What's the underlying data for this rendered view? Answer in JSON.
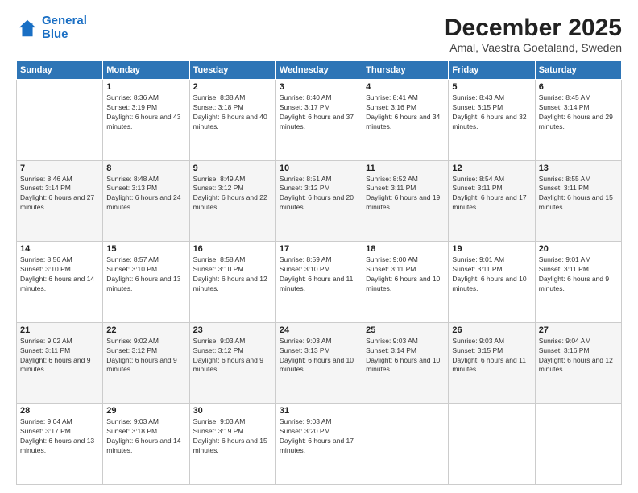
{
  "logo": {
    "line1": "General",
    "line2": "Blue"
  },
  "title": "December 2025",
  "subtitle": "Amal, Vaestra Goetaland, Sweden",
  "days_of_week": [
    "Sunday",
    "Monday",
    "Tuesday",
    "Wednesday",
    "Thursday",
    "Friday",
    "Saturday"
  ],
  "weeks": [
    [
      {
        "day": "",
        "sunrise": "",
        "sunset": "",
        "daylight": ""
      },
      {
        "day": "1",
        "sunrise": "Sunrise: 8:36 AM",
        "sunset": "Sunset: 3:19 PM",
        "daylight": "Daylight: 6 hours and 43 minutes."
      },
      {
        "day": "2",
        "sunrise": "Sunrise: 8:38 AM",
        "sunset": "Sunset: 3:18 PM",
        "daylight": "Daylight: 6 hours and 40 minutes."
      },
      {
        "day": "3",
        "sunrise": "Sunrise: 8:40 AM",
        "sunset": "Sunset: 3:17 PM",
        "daylight": "Daylight: 6 hours and 37 minutes."
      },
      {
        "day": "4",
        "sunrise": "Sunrise: 8:41 AM",
        "sunset": "Sunset: 3:16 PM",
        "daylight": "Daylight: 6 hours and 34 minutes."
      },
      {
        "day": "5",
        "sunrise": "Sunrise: 8:43 AM",
        "sunset": "Sunset: 3:15 PM",
        "daylight": "Daylight: 6 hours and 32 minutes."
      },
      {
        "day": "6",
        "sunrise": "Sunrise: 8:45 AM",
        "sunset": "Sunset: 3:14 PM",
        "daylight": "Daylight: 6 hours and 29 minutes."
      }
    ],
    [
      {
        "day": "7",
        "sunrise": "Sunrise: 8:46 AM",
        "sunset": "Sunset: 3:14 PM",
        "daylight": "Daylight: 6 hours and 27 minutes."
      },
      {
        "day": "8",
        "sunrise": "Sunrise: 8:48 AM",
        "sunset": "Sunset: 3:13 PM",
        "daylight": "Daylight: 6 hours and 24 minutes."
      },
      {
        "day": "9",
        "sunrise": "Sunrise: 8:49 AM",
        "sunset": "Sunset: 3:12 PM",
        "daylight": "Daylight: 6 hours and 22 minutes."
      },
      {
        "day": "10",
        "sunrise": "Sunrise: 8:51 AM",
        "sunset": "Sunset: 3:12 PM",
        "daylight": "Daylight: 6 hours and 20 minutes."
      },
      {
        "day": "11",
        "sunrise": "Sunrise: 8:52 AM",
        "sunset": "Sunset: 3:11 PM",
        "daylight": "Daylight: 6 hours and 19 minutes."
      },
      {
        "day": "12",
        "sunrise": "Sunrise: 8:54 AM",
        "sunset": "Sunset: 3:11 PM",
        "daylight": "Daylight: 6 hours and 17 minutes."
      },
      {
        "day": "13",
        "sunrise": "Sunrise: 8:55 AM",
        "sunset": "Sunset: 3:11 PM",
        "daylight": "Daylight: 6 hours and 15 minutes."
      }
    ],
    [
      {
        "day": "14",
        "sunrise": "Sunrise: 8:56 AM",
        "sunset": "Sunset: 3:10 PM",
        "daylight": "Daylight: 6 hours and 14 minutes."
      },
      {
        "day": "15",
        "sunrise": "Sunrise: 8:57 AM",
        "sunset": "Sunset: 3:10 PM",
        "daylight": "Daylight: 6 hours and 13 minutes."
      },
      {
        "day": "16",
        "sunrise": "Sunrise: 8:58 AM",
        "sunset": "Sunset: 3:10 PM",
        "daylight": "Daylight: 6 hours and 12 minutes."
      },
      {
        "day": "17",
        "sunrise": "Sunrise: 8:59 AM",
        "sunset": "Sunset: 3:10 PM",
        "daylight": "Daylight: 6 hours and 11 minutes."
      },
      {
        "day": "18",
        "sunrise": "Sunrise: 9:00 AM",
        "sunset": "Sunset: 3:11 PM",
        "daylight": "Daylight: 6 hours and 10 minutes."
      },
      {
        "day": "19",
        "sunrise": "Sunrise: 9:01 AM",
        "sunset": "Sunset: 3:11 PM",
        "daylight": "Daylight: 6 hours and 10 minutes."
      },
      {
        "day": "20",
        "sunrise": "Sunrise: 9:01 AM",
        "sunset": "Sunset: 3:11 PM",
        "daylight": "Daylight: 6 hours and 9 minutes."
      }
    ],
    [
      {
        "day": "21",
        "sunrise": "Sunrise: 9:02 AM",
        "sunset": "Sunset: 3:11 PM",
        "daylight": "Daylight: 6 hours and 9 minutes."
      },
      {
        "day": "22",
        "sunrise": "Sunrise: 9:02 AM",
        "sunset": "Sunset: 3:12 PM",
        "daylight": "Daylight: 6 hours and 9 minutes."
      },
      {
        "day": "23",
        "sunrise": "Sunrise: 9:03 AM",
        "sunset": "Sunset: 3:12 PM",
        "daylight": "Daylight: 6 hours and 9 minutes."
      },
      {
        "day": "24",
        "sunrise": "Sunrise: 9:03 AM",
        "sunset": "Sunset: 3:13 PM",
        "daylight": "Daylight: 6 hours and 10 minutes."
      },
      {
        "day": "25",
        "sunrise": "Sunrise: 9:03 AM",
        "sunset": "Sunset: 3:14 PM",
        "daylight": "Daylight: 6 hours and 10 minutes."
      },
      {
        "day": "26",
        "sunrise": "Sunrise: 9:03 AM",
        "sunset": "Sunset: 3:15 PM",
        "daylight": "Daylight: 6 hours and 11 minutes."
      },
      {
        "day": "27",
        "sunrise": "Sunrise: 9:04 AM",
        "sunset": "Sunset: 3:16 PM",
        "daylight": "Daylight: 6 hours and 12 minutes."
      }
    ],
    [
      {
        "day": "28",
        "sunrise": "Sunrise: 9:04 AM",
        "sunset": "Sunset: 3:17 PM",
        "daylight": "Daylight: 6 hours and 13 minutes."
      },
      {
        "day": "29",
        "sunrise": "Sunrise: 9:03 AM",
        "sunset": "Sunset: 3:18 PM",
        "daylight": "Daylight: 6 hours and 14 minutes."
      },
      {
        "day": "30",
        "sunrise": "Sunrise: 9:03 AM",
        "sunset": "Sunset: 3:19 PM",
        "daylight": "Daylight: 6 hours and 15 minutes."
      },
      {
        "day": "31",
        "sunrise": "Sunrise: 9:03 AM",
        "sunset": "Sunset: 3:20 PM",
        "daylight": "Daylight: 6 hours and 17 minutes."
      },
      {
        "day": "",
        "sunrise": "",
        "sunset": "",
        "daylight": ""
      },
      {
        "day": "",
        "sunrise": "",
        "sunset": "",
        "daylight": ""
      },
      {
        "day": "",
        "sunrise": "",
        "sunset": "",
        "daylight": ""
      }
    ]
  ]
}
